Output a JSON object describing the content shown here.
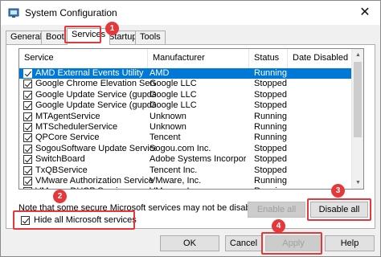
{
  "window": {
    "title": "System Configuration",
    "close_glyph": "✕",
    "icon": "system-config-icon"
  },
  "tabs": [
    {
      "label": "General"
    },
    {
      "label": "Boot"
    },
    {
      "label": "Services"
    },
    {
      "label": "Startup"
    },
    {
      "label": "Tools"
    }
  ],
  "active_tab": "Services",
  "columns": [
    "Service",
    "Manufacturer",
    "Status",
    "Date Disabled"
  ],
  "rows": [
    {
      "name": "AMD External Events Utility",
      "manufacturer": "AMD",
      "status": "Running",
      "checked": true,
      "selected": true
    },
    {
      "name": "Google Chrome Elevation Service",
      "manufacturer": "Google LLC",
      "status": "Stopped",
      "checked": true
    },
    {
      "name": "Google Update Service (gupdate)",
      "manufacturer": "Google LLC",
      "status": "Stopped",
      "checked": true
    },
    {
      "name": "Google Update Service (gupdatem)",
      "manufacturer": "Google LLC",
      "status": "Stopped",
      "checked": true
    },
    {
      "name": "MTAgentService",
      "manufacturer": "Unknown",
      "status": "Running",
      "checked": true
    },
    {
      "name": "MTSchedulerService",
      "manufacturer": "Unknown",
      "status": "Running",
      "checked": true
    },
    {
      "name": "QPCore Service",
      "manufacturer": "Tencent",
      "status": "Running",
      "checked": true
    },
    {
      "name": "SogouSoftware Update Service ...",
      "manufacturer": "Sogou.com Inc.",
      "status": "Stopped",
      "checked": true
    },
    {
      "name": "SwitchBoard",
      "manufacturer": "Adobe Systems Incorporated",
      "status": "Stopped",
      "checked": true
    },
    {
      "name": "TxQBService",
      "manufacturer": "Tencent Inc.",
      "status": "Stopped",
      "checked": true
    },
    {
      "name": "VMware Authorization Service",
      "manufacturer": "VMware, Inc.",
      "status": "Running",
      "checked": true
    },
    {
      "name": "VMware DHCP Service",
      "manufacturer": "VMware, Inc.",
      "status": "Running",
      "checked": true
    }
  ],
  "note": "Note that some secure Microsoft services may not be disabled.",
  "buttons": {
    "enable_all": "Enable all",
    "disable_all": "Disable all",
    "ok": "OK",
    "cancel": "Cancel",
    "apply": "Apply",
    "help": "Help"
  },
  "hide_ms": {
    "label": "Hide all Microsoft services",
    "checked": true
  },
  "badges": [
    "1",
    "2",
    "3",
    "4"
  ],
  "colors": {
    "accent": "#e5383b",
    "selection": "#0078d7"
  },
  "scroll": {
    "up": "▲",
    "down": "▼"
  }
}
